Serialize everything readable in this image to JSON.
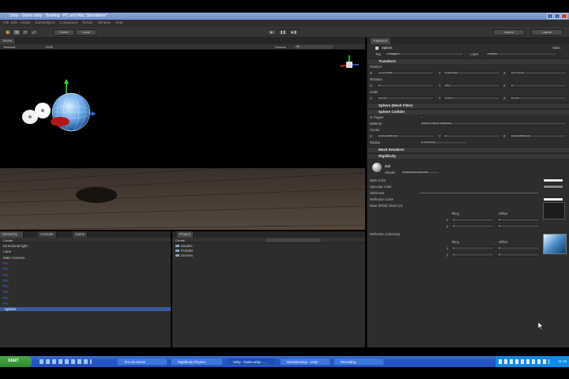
{
  "window": {
    "title": "Unity - Game.unity - Bowling - PC and Mac Standalone*"
  },
  "menu": [
    "File",
    "Edit",
    "Assets",
    "GameObject",
    "Component",
    "Terrain",
    "Window",
    "Help"
  ],
  "toolbar": {
    "pivot_label": "Center",
    "space_label": "Local",
    "layers_label": "Layers",
    "layout_label": "Layout"
  },
  "scene": {
    "tab": "Scene",
    "render_mode": "Textured",
    "color_mode": "RGB",
    "gizmos": "Gizmos",
    "search_placeholder": "All"
  },
  "hierarchy": {
    "tabs": [
      "Hierarchy",
      "Console",
      "Game"
    ],
    "create": "Create",
    "items": [
      {
        "label": "Directional light",
        "color": "#c8c8c8"
      },
      {
        "label": "Lane",
        "color": "#c8c8c8"
      },
      {
        "label": "Main Camera",
        "color": "#c8c8c8"
      },
      {
        "label": "Pin",
        "color": "#3d78d8"
      },
      {
        "label": "Pin",
        "color": "#3d78d8"
      },
      {
        "label": "Pin",
        "color": "#3d78d8"
      },
      {
        "label": "Pin",
        "color": "#3d78d8"
      },
      {
        "label": "Pin",
        "color": "#3d78d8"
      },
      {
        "label": "Pin",
        "color": "#3d78d8"
      },
      {
        "label": "Pin",
        "color": "#3d78d8"
      },
      {
        "label": "Pin",
        "color": "#3d78d8"
      },
      {
        "label": "Sphere",
        "color": "#ffffff",
        "selected": true
      }
    ]
  },
  "project": {
    "tab": "Project",
    "create": "Create",
    "folders": [
      "Models",
      "Prefabs",
      "Scenes"
    ]
  },
  "inspector": {
    "tab": "Inspector",
    "object_name": "Sphere",
    "static_label": "Static",
    "tag_label": "Tag",
    "tag_value": "Untagged",
    "layer_label": "Layer",
    "layer_value": "Default",
    "transform": {
      "title": "Transform",
      "position_label": "Position",
      "position": {
        "x": "-1.337458",
        "y": "0.422684",
        "z": "0.273732"
      },
      "rotation_label": "Rotation",
      "rotation": {
        "x": "0",
        "y": "283",
        "z": "0"
      },
      "scale_label": "Scale",
      "scale": {
        "x": "0.375",
        "y": "0.375",
        "z": "0.375"
      }
    },
    "mesh_filter": {
      "title": "Sphere (Mesh Filter)"
    },
    "collider": {
      "title": "Sphere Collider",
      "is_trigger": "Is Trigger",
      "material_label": "Material",
      "material_value": "None (Physic Material)",
      "center_label": "Center",
      "center": {
        "x": "8.583069e-08",
        "y": "0",
        "z": "8.583069e-08"
      },
      "radius_label": "Radius",
      "radius_value": "0.5000001"
    },
    "mesh_renderer": {
      "title": "Mesh Renderer"
    },
    "rigidbody": {
      "title": "Rigidbody"
    },
    "material": {
      "name": "Ball",
      "shader_label": "Shader",
      "shader_value": "Reflective/Specular",
      "main_color": "Main Color",
      "specular_color": "Specular Color",
      "shininess": "Shininess",
      "reflection_color": "Reflection Color",
      "base_label": "Base (RGB) Gloss (A)",
      "tiling": "Tiling",
      "offset": "Offset",
      "x": "x",
      "y": "y",
      "tiling_values": [
        "1",
        "1"
      ],
      "offset_values": [
        "0",
        "0"
      ],
      "cubemap_label": "Reflection Cubemap",
      "tiling2_values": [
        "1",
        "1"
      ],
      "offset2_values": [
        "0",
        "0"
      ],
      "select": "Select"
    }
  },
  "taskbar": {
    "start": "start",
    "tasks": [
      "Tim-Ab Assets",
      "RigidBody Physics",
      "Unity - Game.unity - ...",
      "MonoDevelop - Unity",
      "Recording..."
    ],
    "clock": "11:19"
  },
  "colors": {
    "selection": "#3b5aa0",
    "scene_bg": "#000000",
    "taskbar": "#2555c6"
  }
}
